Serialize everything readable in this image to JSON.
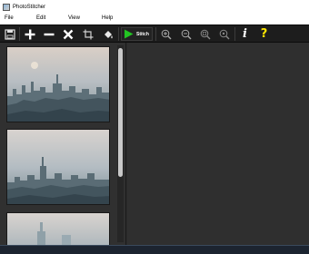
{
  "window": {
    "title": "PhotoStitcher"
  },
  "menu": {
    "file": "File",
    "edit": "Edit",
    "view": "View",
    "help": "Help"
  },
  "toolbar": {
    "stitch_label": "Stitch",
    "info_glyph": "i",
    "help_glyph": "?",
    "icons": [
      "save-icon",
      "plus-icon",
      "minus-icon",
      "close-icon",
      "crop-icon",
      "fill-bucket-icon",
      "play-icon",
      "zoom-in-icon",
      "zoom-out-icon",
      "zoom-fit-icon",
      "zoom-actual-icon",
      "info-icon",
      "help-icon"
    ],
    "accent_green": "#22c422",
    "help_yellow": "#ffe600"
  },
  "thumbnails": [
    {
      "name": "city-skyline-photo-1"
    },
    {
      "name": "city-skyline-photo-2"
    },
    {
      "name": "city-skyline-photo-3"
    }
  ],
  "colors": {
    "toolbar_bg": "#1d1d1d",
    "panel_bg": "#303030",
    "canvas_bg": "#2f2f2f"
  }
}
